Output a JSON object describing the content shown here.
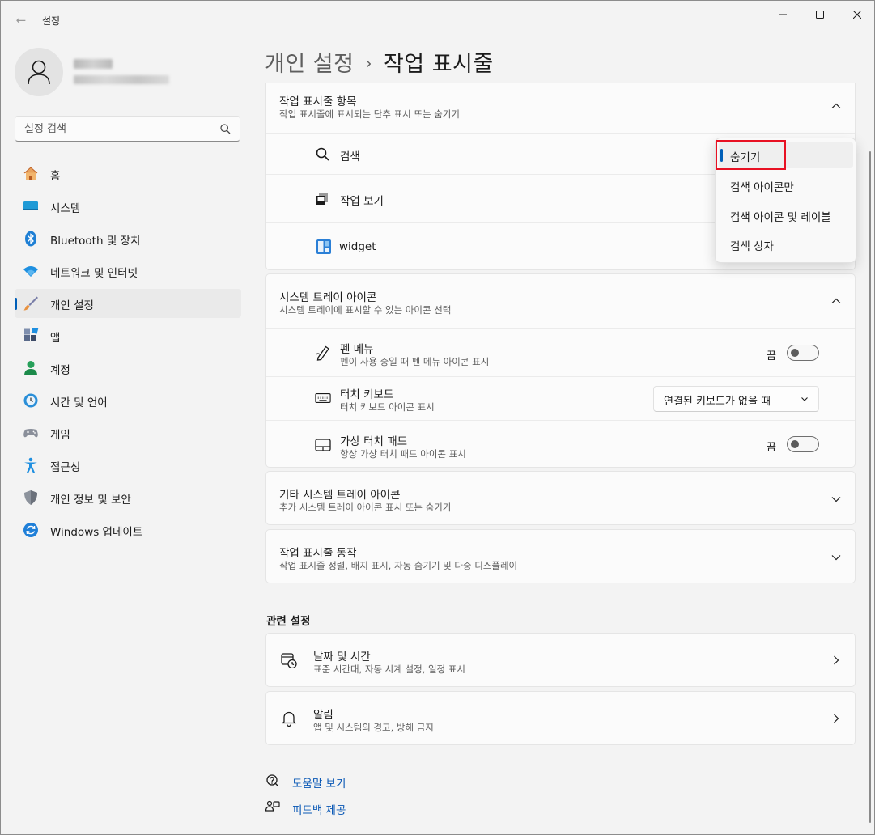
{
  "window": {
    "app_title": "설정",
    "back_glyph": "←",
    "controls": {
      "minimize": "minimize-icon",
      "maximize": "maximize-icon",
      "close": "close-icon"
    }
  },
  "sidebar": {
    "search_placeholder": "설정 검색",
    "items": [
      {
        "label": "홈",
        "icon": "home-icon"
      },
      {
        "label": "시스템",
        "icon": "system-icon"
      },
      {
        "label": "Bluetooth 및 장치",
        "icon": "bluetooth-icon"
      },
      {
        "label": "네트워크 및 인터넷",
        "icon": "wifi-icon"
      },
      {
        "label": "개인 설정",
        "icon": "brush-icon",
        "active": true
      },
      {
        "label": "앱",
        "icon": "apps-icon"
      },
      {
        "label": "계정",
        "icon": "account-icon"
      },
      {
        "label": "시간 및 언어",
        "icon": "time-language-icon"
      },
      {
        "label": "게임",
        "icon": "gamepad-icon"
      },
      {
        "label": "접근성",
        "icon": "accessibility-icon"
      },
      {
        "label": "개인 정보 및 보안",
        "icon": "shield-icon"
      },
      {
        "label": "Windows 업데이트",
        "icon": "update-icon"
      }
    ]
  },
  "header": {
    "parent": "개인 설정",
    "separator": "›",
    "current": "작업 표시줄"
  },
  "taskbar_items": {
    "title": "작업 표시줄 항목",
    "desc": "작업 표시줄에 표시되는 단추 표시 또는 숨기기",
    "rows": [
      {
        "label": "검색",
        "icon": "search-icon"
      },
      {
        "label": "작업 보기",
        "icon": "task-view-icon"
      },
      {
        "label": "widget",
        "icon": "widget-icon"
      }
    ]
  },
  "popup_menu": {
    "options": [
      "숨기기",
      "검색 아이콘만",
      "검색 아이콘 및 레이블",
      "검색 상자"
    ],
    "selected_index": 0
  },
  "system_tray": {
    "title": "시스템 트레이 아이콘",
    "desc": "시스템 트레이에 표시할 수 있는 아이콘 선택",
    "pen": {
      "title": "펜 메뉴",
      "desc": "펜이 사용 중일 때 펜 메뉴 아이콘 표시",
      "state_label": "끔",
      "on": false
    },
    "touch_keyboard": {
      "title": "터치 키보드",
      "desc": "터치 키보드 아이콘 표시",
      "value": "연결된 키보드가 없을 때"
    },
    "touchpad": {
      "title": "가상 터치 패드",
      "desc": "항상 가상 터치 패드 아이콘 표시",
      "state_label": "끔",
      "on": false
    }
  },
  "other_tray": {
    "title": "기타 시스템 트레이 아이콘",
    "desc": "추가 시스템 트레이 아이콘 표시 또는 숨기기"
  },
  "behavior": {
    "title": "작업 표시줄 동작",
    "desc": "작업 표시줄 정렬, 배지 표시, 자동 숨기기 및 다중 디스플레이"
  },
  "related": {
    "heading": "관련 설정",
    "items": [
      {
        "title": "날짜 및 시간",
        "desc": "표준 시간대, 자동 시계 설정, 일정 표시",
        "icon": "calendar-clock-icon"
      },
      {
        "title": "알림",
        "desc": "앱 및 시스템의 경고, 방해 금지",
        "icon": "bell-icon"
      }
    ]
  },
  "links": {
    "help": "도움말 보기",
    "feedback": "피드백 제공"
  },
  "colors": {
    "accent": "#005fb8",
    "link": "#0a58b5",
    "highlight": "#e81123"
  }
}
